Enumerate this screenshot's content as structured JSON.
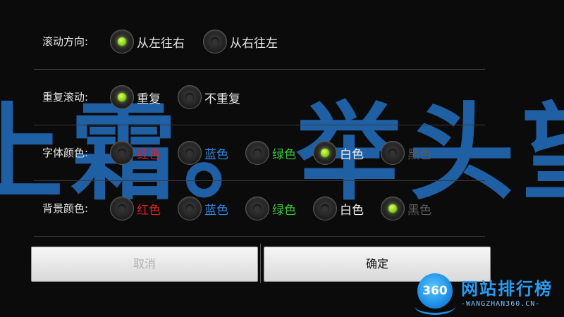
{
  "marquee": {
    "text": "上霜。举头望"
  },
  "settings": {
    "scroll": {
      "label": "滚动方向:",
      "options": [
        {
          "label": "从左往右",
          "color": "#e8e8e8",
          "selected": true
        },
        {
          "label": "从右往左",
          "color": "#e8e8e8",
          "selected": false
        }
      ]
    },
    "repeat": {
      "label": "重复滚动:",
      "options": [
        {
          "label": "重复",
          "color": "#e8e8e8",
          "selected": true
        },
        {
          "label": "不重复",
          "color": "#e8e8e8",
          "selected": false
        }
      ]
    },
    "font_color": {
      "label": "字体颜色:",
      "options": [
        {
          "label": "红色",
          "color": "#e02020",
          "selected": false
        },
        {
          "label": "蓝色",
          "color": "#2f86e0",
          "selected": false
        },
        {
          "label": "绿色",
          "color": "#39c43a",
          "selected": false
        },
        {
          "label": "白色",
          "color": "#f0f0f0",
          "selected": true
        },
        {
          "label": "黑色",
          "color": "#5a5a5a",
          "selected": false
        }
      ]
    },
    "bg_color": {
      "label": "背景颜色:",
      "options": [
        {
          "label": "红色",
          "color": "#e02020",
          "selected": false
        },
        {
          "label": "蓝色",
          "color": "#2f86e0",
          "selected": false
        },
        {
          "label": "绿色",
          "color": "#39c43a",
          "selected": false
        },
        {
          "label": "白色",
          "color": "#f0f0f0",
          "selected": false
        },
        {
          "label": "黑色",
          "color": "#5a5a5a",
          "selected": true
        }
      ]
    }
  },
  "buttons": {
    "cancel": "取消",
    "ok": "确定"
  },
  "watermark": {
    "badge": "360",
    "title": "网站排行榜",
    "subtitle": "-WANGZHAN360.CN-"
  }
}
